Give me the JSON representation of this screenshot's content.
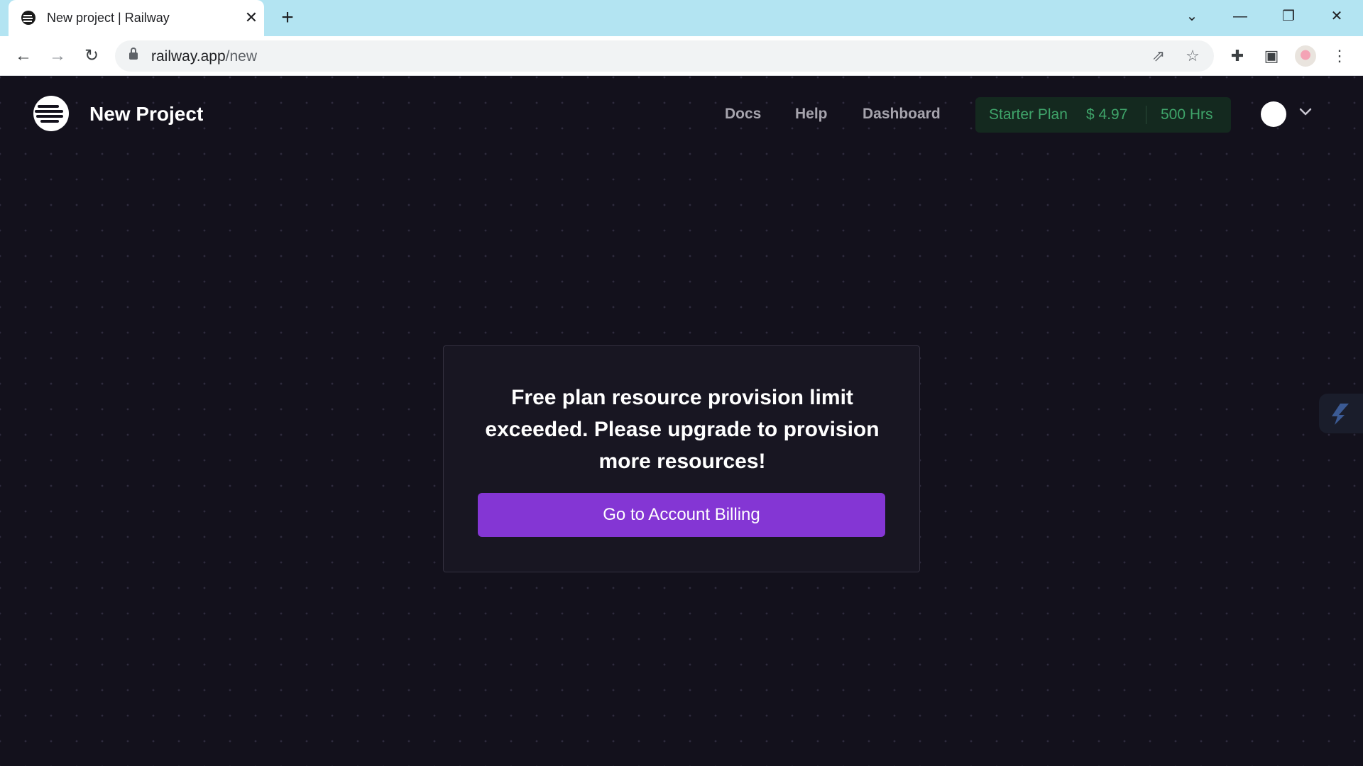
{
  "browser": {
    "tab_title": "New project | Railway",
    "tab_close_glyph": "✕",
    "new_tab_glyph": "+",
    "window_controls": {
      "dropdown": "⌄",
      "minimize": "—",
      "restore": "❐",
      "close": "✕"
    },
    "nav": {
      "back": "←",
      "forward": "→",
      "reload": "↻"
    },
    "url_host": "railway.app",
    "url_path": "/new",
    "icons": [
      "share-icon",
      "star-icon",
      "extensions-icon",
      "sidepanel-icon",
      "profile-avatar",
      "menu-icon"
    ],
    "icon_glyphs": {
      "share": "⇗",
      "star": "☆",
      "extensions": "✚",
      "sidepanel": "▣",
      "menu": "⋮"
    }
  },
  "app": {
    "title": "New Project",
    "nav": {
      "docs": "Docs",
      "help": "Help",
      "dashboard": "Dashboard"
    },
    "plan": {
      "name": "Starter Plan",
      "credit": "$ 4.97",
      "hours": "500 Hrs"
    },
    "colors": {
      "background": "#13111c",
      "accent": "#8436d4",
      "plan_text": "#3fa46a"
    }
  },
  "card": {
    "message": "Free plan resource provision limit exceeded. Please upgrade to provision more resources!",
    "button_label": "Go to Account Billing"
  }
}
